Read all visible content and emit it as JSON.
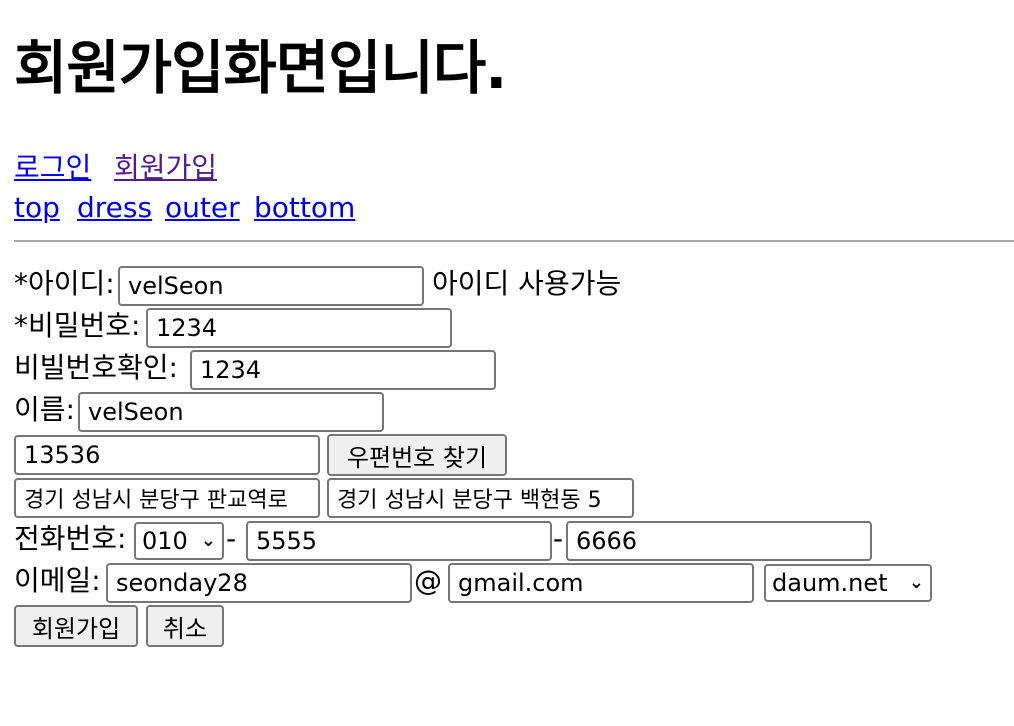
{
  "page_title": "회원가입화면입니다.",
  "nav": {
    "login": "로그인",
    "join": "회원가입",
    "categories": [
      "top",
      "dress",
      "outer",
      "bottom"
    ]
  },
  "form": {
    "id_label": "*아이디:",
    "id_value": "velSeon",
    "id_status": "아이디 사용가능",
    "pw_label": "*비밀번호:",
    "pw_value": "1234",
    "pw_confirm_label": "비빌번호확인:",
    "pw_confirm_value": "1234",
    "name_label": "이름:",
    "name_value": "velSeon",
    "zipcode_value": "13536",
    "zipcode_button": "우편번호 찾기",
    "road_address_value": "경기 성남시 분당구 판교역로",
    "jibun_address_value": "경기 성남시 분당구 백현동 5",
    "phone_label": "전화번호:",
    "phone_prefix": "010",
    "phone_sep": "-",
    "phone_mid": "5555",
    "phone_last": "6666",
    "email_label": "이메일:",
    "email_user": "seonday28",
    "email_at": "@",
    "email_domain": "gmail.com",
    "email_domain_select": "daum.net",
    "submit_button": "회원가입",
    "cancel_button": "취소"
  },
  "icons": {
    "select_arrow": "chevron-down-icon"
  },
  "colors": {
    "link": "#0000ee",
    "visited_link": "#551a8b",
    "button_bg": "#efefef",
    "border": "#767676"
  }
}
